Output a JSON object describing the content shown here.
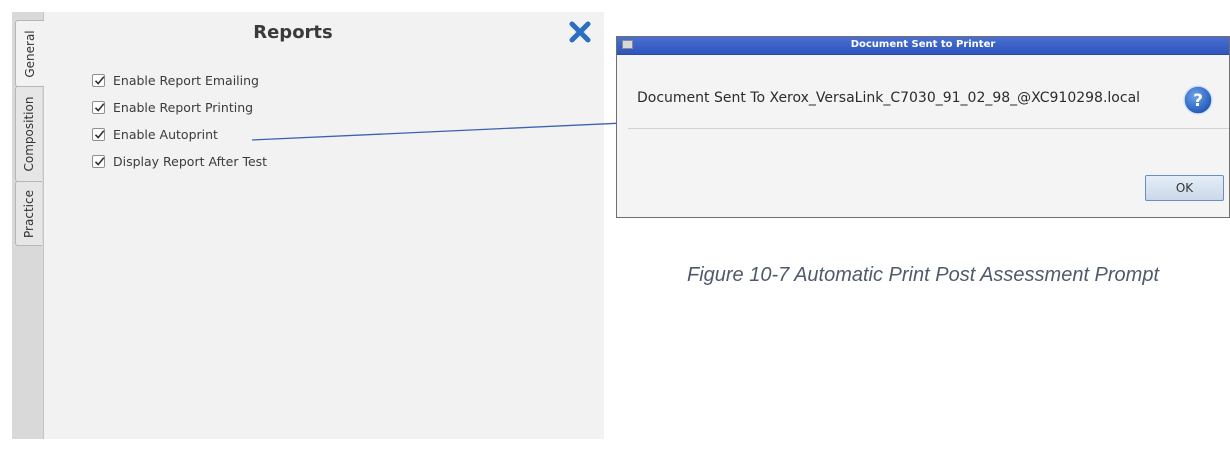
{
  "settings_panel": {
    "title": "Reports",
    "tabs": [
      {
        "label": "General",
        "active": true
      },
      {
        "label": "Composition",
        "active": false
      },
      {
        "label": "Practice",
        "active": false
      }
    ],
    "close_icon": "close-x-icon",
    "options": [
      {
        "label": "Enable Report Emailing",
        "checked": true
      },
      {
        "label": "Enable Report Printing",
        "checked": true
      },
      {
        "label": "Enable Autoprint",
        "checked": true
      },
      {
        "label": "Display Report After Test",
        "checked": true
      }
    ]
  },
  "dialog": {
    "title": "Document Sent to Printer",
    "message": "Document Sent To Xerox_VersaLink_C7030_91_02_98_@XC910298.local",
    "icon": "question-icon",
    "ok_label": "OK"
  },
  "caption": "Figure 10-7 Automatic Print Post Assessment Prompt",
  "colors": {
    "accent_blue": "#2b6cc4",
    "titlebar_blue": "#3a5fc8",
    "connector": "#3a62b0"
  }
}
